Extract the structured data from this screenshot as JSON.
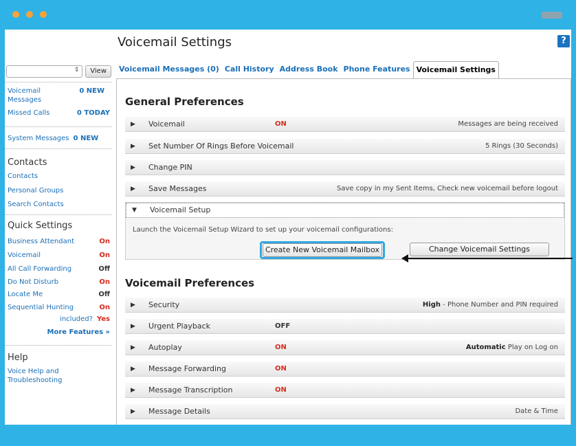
{
  "page_title": "Voicemail Settings",
  "help_icon_label": "?",
  "sidebar": {
    "view_button": "View",
    "messages": [
      {
        "label": "Voicemail Messages",
        "count": "0 NEW"
      },
      {
        "label": "Missed Calls",
        "count": "0 TODAY"
      }
    ],
    "system_messages": {
      "label": "System Messages",
      "count": "0 NEW"
    },
    "contacts_heading": "Contacts",
    "contacts_links": [
      "Contacts",
      "Personal Groups",
      "Search Contacts"
    ],
    "quick_settings_heading": "Quick Settings",
    "quick_settings": [
      {
        "label": "Business Attendant",
        "state": "On"
      },
      {
        "label": "Voicemail",
        "state": "On"
      },
      {
        "label": "All Call Forwarding",
        "state": "Off"
      },
      {
        "label": "Do Not Disturb",
        "state": "On"
      },
      {
        "label": "Locate Me",
        "state": "Off"
      },
      {
        "label": "Sequential Hunting",
        "state": "On"
      }
    ],
    "included_label": "included?",
    "included_value": "Yes",
    "more_features": "More Features »",
    "help_heading": "Help",
    "help_link": "Voice Help and Troubleshooting"
  },
  "tabs": [
    {
      "label": "Voicemail Messages (0)",
      "active": false
    },
    {
      "label": "Call History",
      "active": false
    },
    {
      "label": "Address Book",
      "active": false
    },
    {
      "label": "Phone Features",
      "active": false
    },
    {
      "label": "Voicemail Settings",
      "active": true
    }
  ],
  "general": {
    "title": "General Preferences",
    "rows": [
      {
        "label": "Voicemail",
        "value": "ON",
        "desc": "Messages are being received"
      },
      {
        "label": "Set Number Of Rings Before Voicemail",
        "value": "",
        "desc": "5 Rings (30 Seconds)"
      },
      {
        "label": "Change PIN",
        "value": "",
        "desc": ""
      },
      {
        "label": "Save Messages",
        "value": "",
        "desc": "Save copy in my Sent Items, Check new voicemail before logout"
      }
    ],
    "setup": {
      "label": "Voicemail Setup",
      "text": "Launch the Voicemail Setup Wizard to set up your voicemail configurations:",
      "create_button": "Create New Voicemail Mailbox",
      "change_button": "Change Voicemail Settings"
    }
  },
  "voicemail_prefs": {
    "title": "Voicemail Preferences",
    "rows": [
      {
        "label": "Security",
        "value": "",
        "desc_bold": "High",
        "desc": " - Phone Number and PIN required"
      },
      {
        "label": "Urgent Playback",
        "value": "OFF",
        "desc_bold": "",
        "desc": ""
      },
      {
        "label": "Autoplay",
        "value": "ON",
        "desc_bold": "Automatic",
        "desc": " Play on Log on"
      },
      {
        "label": "Message Forwarding",
        "value": "ON",
        "desc_bold": "",
        "desc": ""
      },
      {
        "label": "Message Transcription",
        "value": "ON",
        "desc_bold": "",
        "desc": ""
      },
      {
        "label": "Message Details",
        "value": "",
        "desc_bold": "",
        "desc": "Date & Time"
      }
    ]
  },
  "colors": {
    "chrome": "#2fb2e6",
    "dots": "#f7a23b",
    "link": "#1a6fb8",
    "on": "#d62b1f",
    "highlight": "#2fa8e0"
  }
}
